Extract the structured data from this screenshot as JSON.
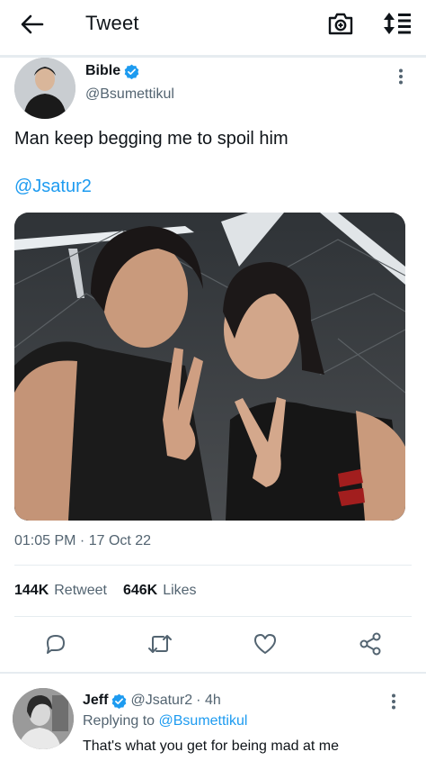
{
  "header": {
    "title": "Tweet",
    "back_icon": "arrow-left-icon",
    "camera_icon": "camera-icon",
    "sort_icon": "sort-icon"
  },
  "tweet": {
    "author_name": "Bible",
    "author_handle": "@Bsumettikul",
    "text": "Man keep begging me to spoil him",
    "mention": "@Jsatur2",
    "timestamp": "01:05 PM · 17 Oct 22",
    "retweets": {
      "count": "144K",
      "label": "Retweet"
    },
    "likes": {
      "count": "646K",
      "label": "Likes"
    }
  },
  "reply": {
    "author_name": "Jeff",
    "author_handle": "@Jsatur2",
    "time": "· 4h",
    "replying_label": "Replying to",
    "replying_to": "@Bsumettikul",
    "text": "That's what you get for being mad at me"
  },
  "colors": {
    "accent": "#1d9bf0",
    "text": "#0f1419",
    "secondary": "#536471",
    "divider": "#e6ecf0"
  }
}
